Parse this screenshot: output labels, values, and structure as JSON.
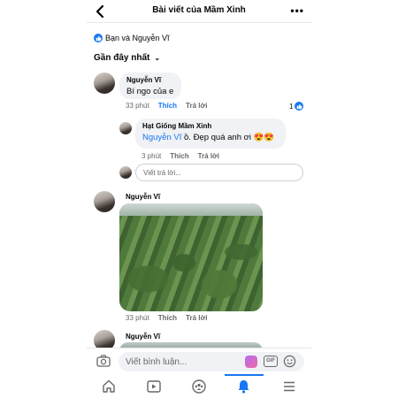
{
  "header": {
    "title": "Bài viết của Mầm Xinh"
  },
  "reactions": {
    "text": "Bạn và Nguyễn Vĩ"
  },
  "sort": {
    "label": "Gần đây nhất"
  },
  "comments": [
    {
      "name": "Nguyễn Vĩ",
      "text": "Bí ngo của e",
      "time": "33 phút",
      "like": "Thích",
      "reply": "Trả lời",
      "like_count": "1"
    },
    {
      "name": "Hạt Giống Mầm Xinh",
      "mention": "Nguyễn Vĩ",
      "text": " ồ. Đẹp quá anh ơi 😍😍",
      "time": "3 phút",
      "like": "Thích",
      "reply": "Trả lời"
    },
    {
      "name": "Nguyễn Vĩ",
      "time": "33 phút",
      "like": "Thích",
      "reply": "Trả lời"
    },
    {
      "name": "Nguyễn Vĩ"
    }
  ],
  "reply_box": {
    "placeholder": "Viết trả lời..."
  },
  "composer": {
    "placeholder": "Viết bình luận...",
    "gif": "GIF"
  },
  "nav": {
    "items": [
      "home-icon",
      "video-icon",
      "groups-icon",
      "notifications-icon",
      "menu-icon"
    ],
    "active": "notifications-icon"
  },
  "colors": {
    "accent": "#1877f2",
    "bubble": "#f0f2f5",
    "muted": "#65676b"
  }
}
